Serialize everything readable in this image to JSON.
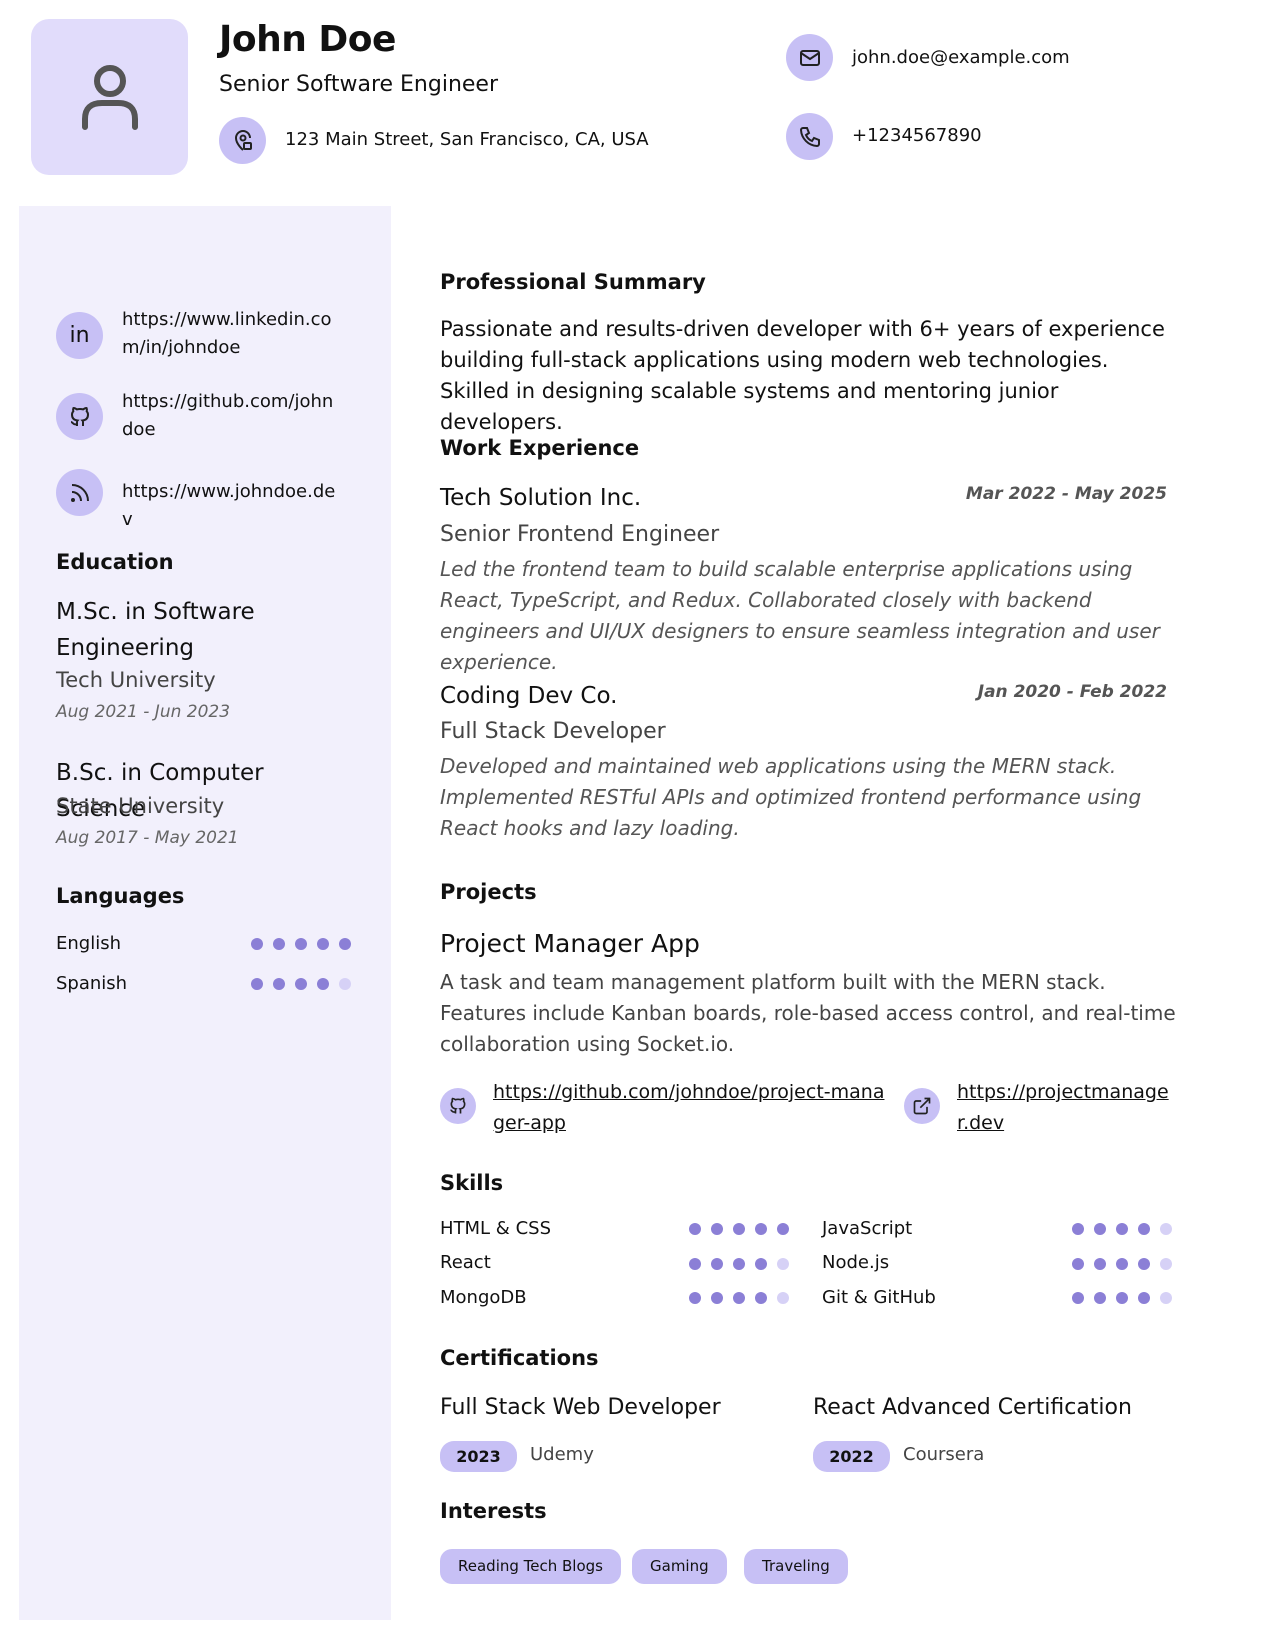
{
  "header": {
    "name": "John Doe",
    "title": "Senior Software Engineer",
    "address": "123 Main Street, San Francisco, CA, USA",
    "email": "john.doe@example.com",
    "phone": "+1234567890"
  },
  "links": {
    "linkedin": "https://www.linkedin.com/in/johndoe",
    "github": "https://github.com/johndoe",
    "website": "https://www.johndoe.dev"
  },
  "sections": {
    "education": "Education",
    "languages": "Languages",
    "summary": "Professional Summary",
    "experience": "Work Experience",
    "projects": "Projects",
    "skills": "Skills",
    "certifications": "Certifications",
    "interests": "Interests"
  },
  "education": [
    {
      "degree": "M.Sc. in Software Engineering",
      "school": "Tech University",
      "dates": "Aug 2021 - Jun 2023"
    },
    {
      "degree": "B.Sc. in Computer Science",
      "school": "State University",
      "dates": "Aug 2017 - May 2021"
    }
  ],
  "languages": [
    {
      "name": "English",
      "level": 5
    },
    {
      "name": "Spanish",
      "level": 4
    }
  ],
  "summary": "Passionate and results-driven developer with 6+ years of experience building full-stack applications using modern web technologies. Skilled in designing scalable systems and mentoring junior developers.",
  "experience": [
    {
      "company": "Tech Solution Inc.",
      "dates": "Mar 2022 - May 2025",
      "role": "Senior Frontend Engineer",
      "description": "Led the frontend team to build scalable enterprise applications using React, TypeScript, and Redux. Collaborated closely with backend engineers and UI/UX designers to ensure seamless integration and user experience."
    },
    {
      "company": "Coding Dev Co.",
      "dates": "Jan 2020 - Feb 2022",
      "role": "Full Stack Developer",
      "description": "Developed and maintained web applications using the MERN stack. Implemented RESTful APIs and optimized frontend performance using React hooks and lazy loading."
    }
  ],
  "project": {
    "name": "Project Manager App",
    "description": "A task and team management platform built with the MERN stack. Features include Kanban boards, role-based access control, and real-time collaboration using Socket.io.",
    "repo": "https://github.com/johndoe/project-manager-app",
    "live": "https://projectmanager.dev"
  },
  "skills": [
    {
      "name": "HTML & CSS",
      "level": 5
    },
    {
      "name": "JavaScript",
      "level": 4
    },
    {
      "name": "React",
      "level": 4
    },
    {
      "name": "Node.js",
      "level": 4
    },
    {
      "name": "MongoDB",
      "level": 4
    },
    {
      "name": "Git & GitHub",
      "level": 4
    }
  ],
  "certifications": [
    {
      "name": "Full Stack Web Developer",
      "year": "2023",
      "org": "Udemy"
    },
    {
      "name": "React Advanced Certification",
      "year": "2022",
      "org": "Coursera"
    }
  ],
  "interests": [
    "Reading Tech Blogs",
    "Gaming",
    "Traveling"
  ],
  "colors": {
    "accent": "#c7c0f5",
    "dot": "#8b7fd6",
    "dot_off": "#d6d1f6",
    "sidebar": "#f2f0fc"
  }
}
